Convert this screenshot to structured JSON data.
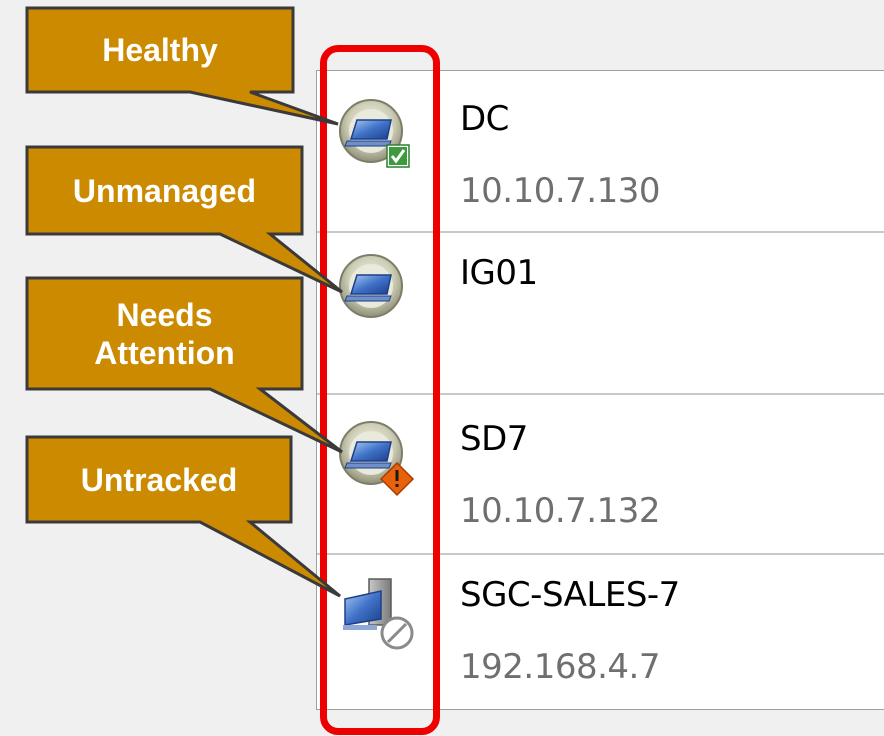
{
  "legend": {
    "healthy": "Healthy",
    "unmanaged": "Unmanaged",
    "needs_attention": "Needs Attention",
    "untracked": "Untracked"
  },
  "devices": [
    {
      "name": "DC",
      "ip": "10.10.7.130",
      "status": "healthy",
      "icon": "computer-healthy-icon"
    },
    {
      "name": "IG01",
      "ip": "",
      "status": "unmanaged",
      "icon": "computer-unmanaged-icon"
    },
    {
      "name": "SD7",
      "ip": "10.10.7.132",
      "status": "needs-attention",
      "icon": "computer-warning-icon"
    },
    {
      "name": "SGC-SALES-7",
      "ip": "192.168.4.7",
      "status": "untracked",
      "icon": "computer-untracked-icon"
    }
  ],
  "colors": {
    "callout_fill": "#cc8a00",
    "callout_border": "#3a3a3a",
    "highlight": "#ee0000",
    "ip_text": "#6f6f6f",
    "divider": "#c8c8c8",
    "check_badge": "#3e9a3e",
    "warning_badge": "#e8620c"
  }
}
